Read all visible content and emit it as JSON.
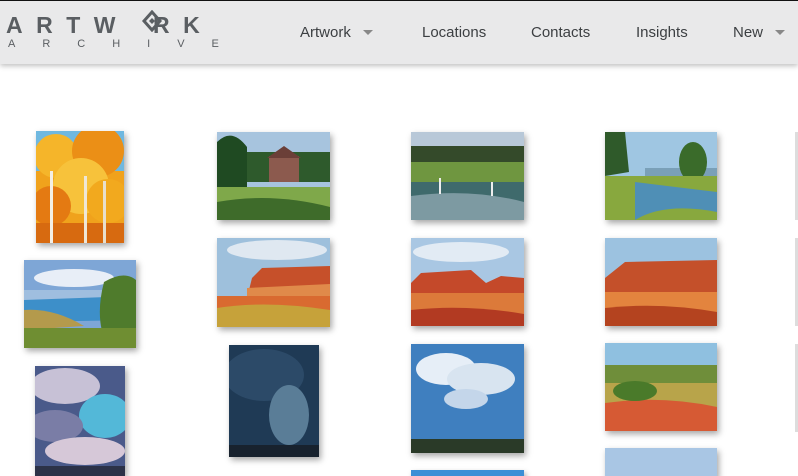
{
  "logo": {
    "word": "ARTWRK",
    "sub": "ARCHIVE"
  },
  "nav": {
    "artwork": "Artwork",
    "locations": "Locations",
    "contacts": "Contacts",
    "insights": "Insights",
    "new": "New"
  },
  "colors": {
    "header_bg": "#e9e9ea",
    "logo": "#5a5e62",
    "nav_text": "#3c3f42"
  },
  "gallery": [
    "aspen-trees-painting",
    "manor-house-landscape",
    "river-marsh-painting",
    "river-trees-painting",
    "coastal-bay-painting",
    "red-mesa-painting-1",
    "red-mesa-painting-2",
    "red-mesa-painting-3",
    "storm-clouds-painting",
    "dark-rain-sky-painting",
    "cumulus-clouds-painting",
    "desert-wash-painting"
  ]
}
